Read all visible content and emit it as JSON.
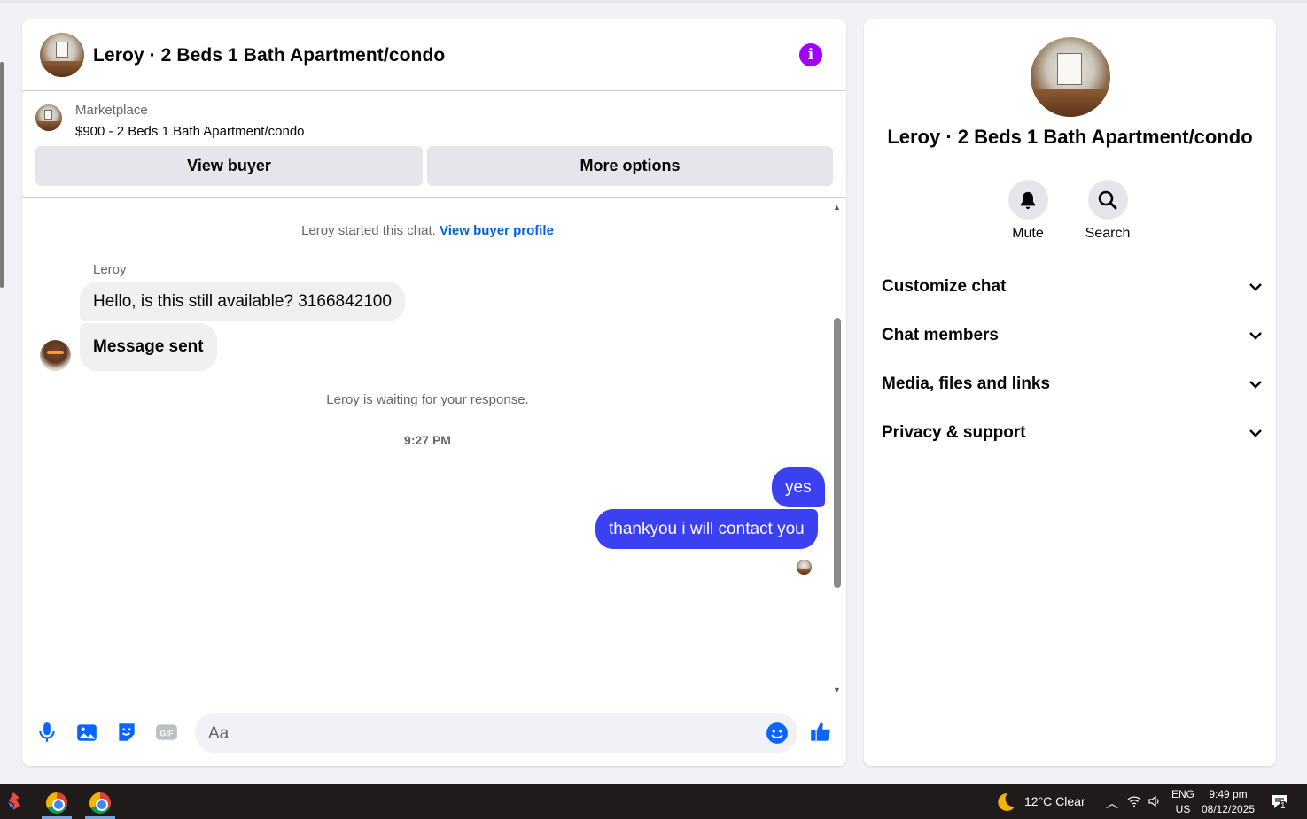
{
  "chat": {
    "title": "Leroy · 2 Beds 1 Bath Apartment/condo",
    "listing": {
      "source": "Marketplace",
      "price_title": "$900 - 2 Beds 1 Bath Apartment/condo",
      "view_buyer_label": "View buyer",
      "more_options_label": "More options"
    },
    "started_text": "Leroy started this chat.",
    "view_buyer_profile_link": "View buyer profile",
    "sender_name": "Leroy",
    "incoming": [
      "Hello, is this still available? 3166842100",
      "Message sent"
    ],
    "waiting_text": "Leroy is waiting for your response.",
    "timestamp": "9:27 PM",
    "outgoing": [
      "yes",
      "thankyou i will contact you"
    ],
    "composer": {
      "placeholder": "Aa"
    },
    "accent_color": "#3b41f0",
    "info_color": "#a100ff"
  },
  "info_panel": {
    "title": "Leroy · 2 Beds 1 Bath Apartment/condo",
    "actions": [
      {
        "label": "Mute",
        "icon": "bell-icon"
      },
      {
        "label": "Search",
        "icon": "search-icon"
      }
    ],
    "sections": [
      {
        "label": "Customize chat"
      },
      {
        "label": "Chat members"
      },
      {
        "label": "Media, files and links"
      },
      {
        "label": "Privacy & support"
      }
    ]
  },
  "taskbar": {
    "weather": "12°C  Clear",
    "language_line1": "ENG",
    "language_line2": "US",
    "time": "9:49 pm",
    "date": "08/12/2025",
    "notification_count": "1"
  }
}
